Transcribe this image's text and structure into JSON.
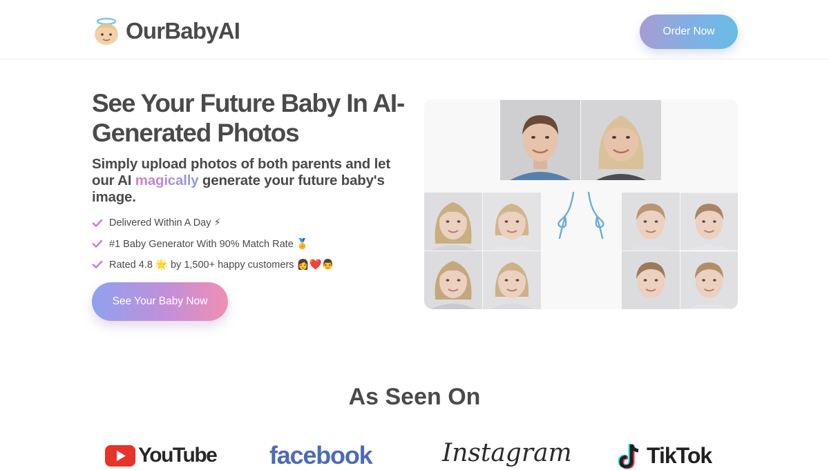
{
  "header": {
    "logo_text": "OurBabyAI",
    "logo_icon": "angel-baby-emoji",
    "order_label": "Order Now"
  },
  "hero": {
    "title": "See Your Future Baby In AI-Generated Photos",
    "subtitle_before": "Simply upload photos of both parents and let our AI ",
    "subtitle_highlight": "magically",
    "subtitle_after": " generate your future baby's image.",
    "features": [
      {
        "text": "Delivered Within A Day ⚡"
      },
      {
        "text": "#1 Baby Generator With 90% Match Rate 🏅"
      },
      {
        "text": "Rated 4.8 🌟 by 1,500+ happy customers 👩❤️👨"
      }
    ],
    "cta_label": "See Your Baby Now"
  },
  "collage": {
    "parents": [
      "father-photo",
      "mother-photo"
    ],
    "children_left": [
      "girl-photo-1",
      "girl-photo-2",
      "girl-photo-3",
      "girl-photo-4"
    ],
    "children_right": [
      "boy-photo-1",
      "boy-photo-2",
      "boy-photo-3",
      "boy-photo-4"
    ]
  },
  "seen_on": {
    "title": "As Seen On",
    "brands": [
      "YouTube",
      "facebook",
      "Instagram",
      "TikTok"
    ]
  },
  "colors": {
    "text": "#4a4a4a",
    "check": "#c77fd6",
    "order_gradient": [
      "#a79bd3",
      "#68bde8"
    ],
    "cta_gradient": [
      "#8fa1f0",
      "#ef8fb4"
    ]
  }
}
